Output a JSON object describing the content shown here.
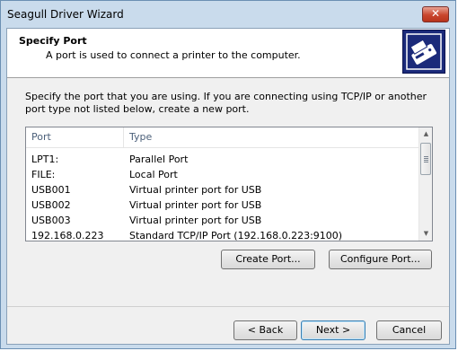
{
  "window": {
    "title": "Seagull Driver Wizard",
    "close_label": "✕"
  },
  "header": {
    "title": "Specify Port",
    "subtitle": "A port is used to connect a printer to the computer."
  },
  "description": "Specify the port that you are using.  If you are connecting using TCP/IP or another port type not listed below, create a new port.",
  "list": {
    "columns": [
      "Port",
      "Type"
    ],
    "rows": [
      {
        "port": "LPT1:",
        "type": "Parallel Port"
      },
      {
        "port": "FILE:",
        "type": "Local Port"
      },
      {
        "port": "USB001",
        "type": "Virtual printer port for USB"
      },
      {
        "port": "USB002",
        "type": "Virtual printer port for USB"
      },
      {
        "port": "USB003",
        "type": "Virtual printer port for USB"
      },
      {
        "port": "192.168.0.223",
        "type": "Standard TCP/IP Port (192.168.0.223:9100)"
      }
    ]
  },
  "buttons": {
    "create_port": "Create Port...",
    "configure_port": "Configure Port...",
    "back": "< Back",
    "next": "Next >",
    "cancel": "Cancel"
  },
  "icons": {
    "logo": "printer-icon",
    "scroll_up": "scroll-up-icon",
    "scroll_down": "scroll-down-icon"
  }
}
